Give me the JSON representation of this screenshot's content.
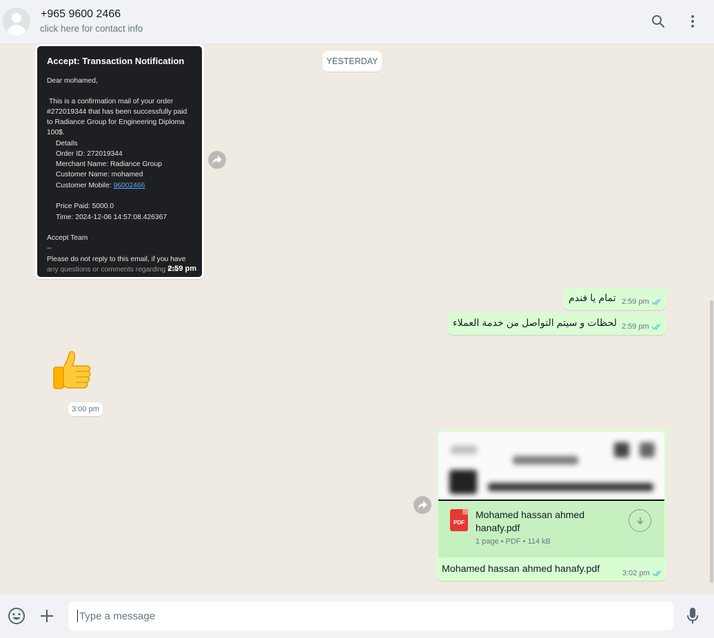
{
  "header": {
    "contact_name": "+965 9600 2466",
    "contact_sub": "click here for contact info",
    "icons": [
      "search-icon",
      "menu-icon"
    ]
  },
  "chat": {
    "date_chip": "YESTERDAY",
    "image_message": {
      "title": "Accept: Transaction Notification",
      "greeting": "Dear mohamed,",
      "lines": [
        "This is a confirmation mail of your order",
        "#272019344 that has been successfully paid",
        "to  Radiance Group for Engineering Diploma",
        "100$.",
        "Details",
        "Order ID: 272019344",
        "Merchant Name: Radiance Group",
        "Customer Name: mohamed",
        "Customer Mobile: ",
        "Price Paid: 5000.0",
        "Time: 2024-12-06 14:57:08.426367",
        "Accept Team",
        "--",
        "Please do not reply to this email, if you have",
        "any questions or comments regarding this"
      ],
      "mobile_link": "96002466",
      "time": "2:59 pm"
    },
    "outgoing": [
      {
        "text": "تمام يا فندم",
        "time": "2:59 pm"
      },
      {
        "text": "لحظات و سيتم التواصل من خدمة العملاء",
        "time": "2:59 pm"
      }
    ],
    "sticker": {
      "emoji": "👍",
      "time": "3:00 pm"
    },
    "document": {
      "name": "Mohamed hassan ahmed hanafy.pdf",
      "pdf_label": "PDF",
      "meta": "1 page • PDF • 114 kB",
      "caption": "Mohamed hassan ahmed hanafy.pdf",
      "time": "3:02 pm"
    }
  },
  "footer": {
    "placeholder": "Type a message",
    "icons": [
      "emoji-icon",
      "attach-plus-icon",
      "microphone-icon"
    ]
  },
  "colors": {
    "outgoing_bubble": "#d9fdd3",
    "chat_bg": "#efeae2",
    "read_ticks": "#53bdeb"
  }
}
